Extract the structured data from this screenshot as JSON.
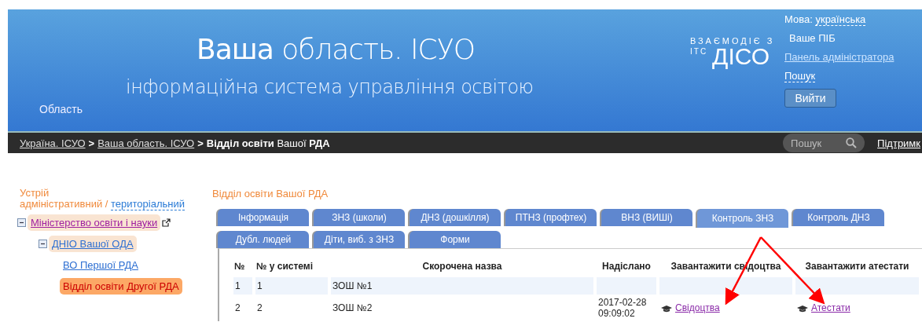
{
  "header": {
    "title_bold": "Ваша",
    "title_rest": "область. ІСУО",
    "subtitle": "інформаційна система управління освітою",
    "region": "Область",
    "partner_small": "ВЗАЄМОДІЄ З",
    "partner_prefix": "ІТС",
    "partner_name": "ДІСО",
    "language_label": "Мова:",
    "language_value": "українська",
    "user_name": "Ваше ПІБ",
    "admin_link": "Панель адміністратора",
    "search_link": "Пошук",
    "logout_button": "Вийти"
  },
  "breadcrumbs": {
    "items": [
      {
        "text": "Україна. ІСУО",
        "kind": "link"
      },
      {
        "text": "**>**",
        "kind": "sep"
      },
      {
        "text": "Ваша область. ІСУО",
        "kind": "link"
      },
      {
        "text": "**>**",
        "kind": "sep"
      },
      {
        "text": "**Відділ освіти** Вашої **РДА**",
        "kind": "current"
      }
    ],
    "search_placeholder": "Пошук",
    "support_link": "Підтримк"
  },
  "sidebar": {
    "label_top": "Устрій",
    "label_admin": "адміністративний /",
    "label_territorial": "територіальний",
    "tree": [
      {
        "text": "Міністерство освіти і науки",
        "external": true,
        "expanded": true,
        "selected": false,
        "children": [
          {
            "text": "ДНІО Вашої ОДА",
            "external": false,
            "expanded": true,
            "selected": false,
            "children": [
              {
                "text": "ВО Першої РДА",
                "external": false,
                "selected": false
              },
              {
                "text": "Відділ освіти  Другої РДА",
                "external": false,
                "selected": true
              }
            ]
          }
        ]
      }
    ]
  },
  "main": {
    "title": "Відділ освіти Вашої РДА",
    "tab_rows": [
      [
        {
          "label": "Інформація",
          "selected": false
        },
        {
          "label": "ЗНЗ (школи)",
          "selected": false
        },
        {
          "label": "ДНЗ (дошкілля)",
          "selected": false
        },
        {
          "label": "ПТНЗ (профтех)",
          "selected": false
        },
        {
          "label": "ВНЗ (ВИШі)",
          "selected": false
        },
        {
          "label": "Контроль ЗНЗ",
          "selected": true
        },
        {
          "label": "Контроль ДНЗ",
          "selected": false
        }
      ],
      [
        {
          "label": "Дубл. людей",
          "selected": false
        },
        {
          "label": "Діти, виб. з ЗНЗ",
          "selected": false
        },
        {
          "label": "Форми",
          "selected": false
        }
      ]
    ],
    "table": {
      "columns": [
        "№",
        "№ у системі",
        "Скорочена назва",
        "Надіслано",
        "Завантажити свідоцтва",
        "Завантажити атестати"
      ],
      "rows": [
        {
          "num": "1",
          "system_num": "1",
          "name": "ЗОШ №1",
          "sent": "",
          "certificates": "",
          "attestats": ""
        },
        {
          "num": "2",
          "system_num": "2",
          "name": "ЗОШ №2",
          "sent": "2017-02-28 09:09:02",
          "certificates": "Свідоцтва",
          "attestats": "Атестати"
        }
      ]
    }
  }
}
